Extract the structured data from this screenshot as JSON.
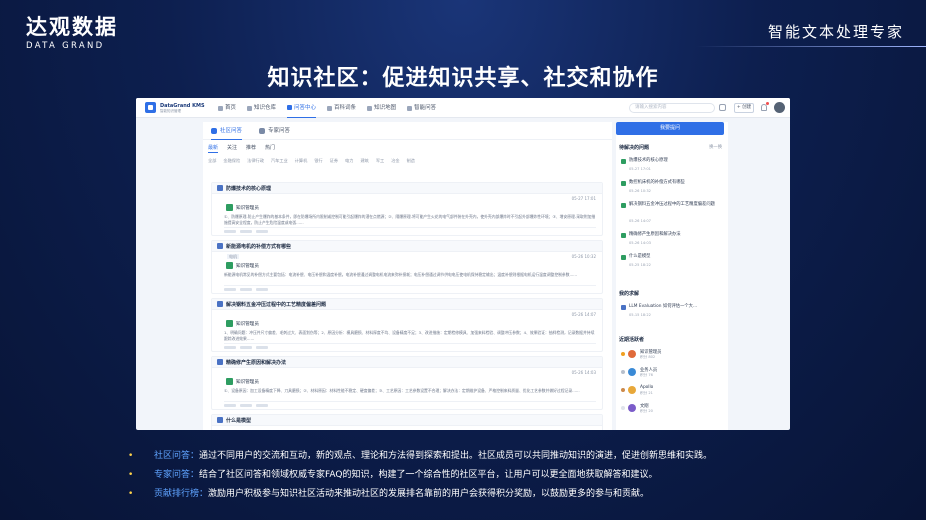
{
  "slide": {
    "logo_cn": "达观数据",
    "logo_en": "DATA GRAND",
    "corner_text": "智能文本处理专家",
    "title": "知识社区：促进知识共享、社交和协作",
    "bullets": [
      {
        "label": "社区问答：",
        "text": "通过不同用户的交流和互动，新的观点、理论和方法得到探索和提出。社区成员可以共同推动知识的演进，促进创新思维和实践。"
      },
      {
        "label": "专家问答：",
        "text": "结合了社区问答和领域权威专家FAQ的知识，构建了一个综合性的社区平台，让用户可以更全面地获取解答和建议。"
      },
      {
        "label": "贡献排行榜：",
        "text": "激励用户积极参与知识社区活动来推动社区的发展排名靠前的用户会获得积分奖励，以鼓励更多的参与和贡献。"
      }
    ]
  },
  "app": {
    "brand_name": "DataGrand KMS",
    "brand_sub": "智能知识管理",
    "nav": [
      "首页",
      "知识仓库",
      "问答中心",
      "百科词条",
      "知识地图",
      "智能问答"
    ],
    "nav_active_index": 2,
    "search_placeholder": "请输入搜索内容",
    "create_label": "+ 创建",
    "subtabs": [
      "社区问答",
      "专家问答"
    ],
    "filters": [
      "最新",
      "关注",
      "推荐",
      "热门"
    ],
    "categories": [
      "全部",
      "金融保险",
      "法律行政",
      "汽车工业",
      "计算机",
      "银行",
      "证券",
      "电力",
      "建筑",
      "军工",
      "冶金",
      "制造"
    ],
    "questions": [
      {
        "title": "防爆技术的核心原理",
        "tag": "",
        "date": "05-27 17:01",
        "user": "知识管理员",
        "body": "①、防爆原理-防止产生爆炸的基本条件，即在防爆场所内限制或控制可能引起爆炸的潜在点燃源；②、隔爆原理-将可能产生火花的电气部件装在外壳内，使外壳内部爆炸时不引起外部爆炸性环境；③、增安原理-采取附加措施提高安全程度，防止产生危险温度或电弧……"
      },
      {
        "title": "新能源电机的补偿方式有哪些",
        "tag": "电机",
        "date": "05-26 10:32",
        "user": "知识管理员",
        "body": "新能源电机常见的补偿方式主要包括：电流补偿、电压补偿和温度补偿。电流补偿通过调整电机电流来弥补损耗；电压补偿通过调节供电电压使电机保持稳定输出；温度补偿则根据电机运行温度调整控制参数……"
      },
      {
        "title": "解决钢料五金冲压过程中的工艺精度偏差问题",
        "tag": "",
        "date": "05-26 14:07",
        "user": "知识管理员",
        "body": "1、明确问题：冲压件尺寸偏差、毛刺过大、表面划伤等；2、原因分析：模具磨损、材料厚度不均、设备精度不足；3、改进措施：定期检修模具、加强来料检验、调整冲压参数；4、效果验证：抽样检测，记录数据并持续跟踪改进效果……"
      },
      {
        "title": "精确修产生原因和解决办法",
        "tag": "",
        "date": "05-26 14:03",
        "user": "知识管理员",
        "body": "①、设备原因：加工设备精度下降、刀具磨损；②、材料原因：材料性能不稳定、硬度偏差；③、工艺原因：工艺参数设置不合理；解决办法：定期维护设备、严格控制来料质量、优化工艺参数并做好过程记录……"
      },
      {
        "title": "什么是模型",
        "tag": "",
        "date": "",
        "user": "",
        "body": ""
      }
    ],
    "ask_button": "我要提问",
    "hot_title": "待解决的问题",
    "hot_more": "换一换",
    "hot_questions": [
      {
        "title": "防爆技术的核心原理",
        "date": "05-27 17:01"
      },
      {
        "title": "数控机床机的补偿方式有哪些",
        "date": "05-26 10:32"
      },
      {
        "title": "解决钢料五金冲压过程中的工艺精度偏差问题",
        "date": "05-26 14:07"
      },
      {
        "title": "精确修产生原因和解决办法",
        "date": "05-26 14:03"
      },
      {
        "title": "什么是模型",
        "date": "05-25 18:22"
      }
    ],
    "my_knowledge_title": "我的求解",
    "my_knowledge": [
      {
        "title": "LLM Evaluation 如何评估一个大...",
        "date": "05-15 18:22"
      }
    ],
    "ranking_title": "近期活跃者",
    "ranking": [
      {
        "name": "知识管理员",
        "score": "积分 802"
      },
      {
        "name": "业务人员",
        "score": "积分 76"
      },
      {
        "name": "Apollo",
        "score": "积分 21"
      },
      {
        "name": "文刚",
        "score": "积分 20"
      }
    ],
    "colors": {
      "accent": "#2f6fe6",
      "slide_bg": "#0d1f4f",
      "bullet_label": "#5fa3ff",
      "bullet_dot": "#ffd24a"
    }
  }
}
